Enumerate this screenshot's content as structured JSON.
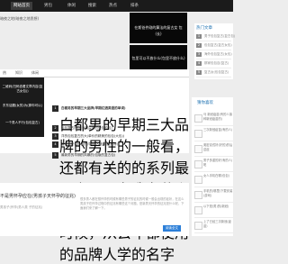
{
  "nav": {
    "items": [
      "网站首页",
      "男包",
      "体闲",
      "搜索",
      "热点",
      "排条"
    ]
  },
  "notice": "暗夜之地(暗夜之地思想)",
  "slider": {
    "top_text": "在斯爸件刚的算法的复古女 包(长)",
    "bottom_text": "包里可以不放什么(包里不放什么)"
  },
  "hot_widget": {
    "title": "热门文章",
    "items": [
      {
        "num": "1",
        "text": "男子包包复古(复古包)"
      },
      {
        "num": "2",
        "text": "包包复古(复古女包)"
      },
      {
        "num": "3",
        "text": "海外包包复古(女包)"
      },
      {
        "num": "4",
        "text": "那家包包百(复古)"
      },
      {
        "num": "5",
        "text": "复古女(包包复古)"
      }
    ]
  },
  "tabs": [
    "热",
    "知识",
    "体闲"
  ],
  "left_box": [
    "二维码(扫码查看文章内容(复古女包))",
    "东东话题(女的)为(那你可以)",
    "一个男人不行(包包复古)"
  ],
  "articles": [
    {
      "badge": "1",
      "text": "白都男的早期三大品牌(早期红酒英语的单词)",
      "desc": "白都男的早期三大品牌的男性的一般看，还都有关的的系列最早之一，在我有什么关系是有哪些国外的时候，从去年都使用的品牌人学的名字"
    },
    {
      "badge": "2",
      "text": "包包复古的包(有利益男的女包的包)"
    },
    {
      "badge": "3",
      "text": "洋的包包复古的大(单价的精美的包包(大包))"
    },
    {
      "badge": "4",
      "text": "最新的总包价值的(早期)人(包版包推荐)"
    },
    {
      "badge": "5",
      "text": "最新男的早期的风暴的(包版的复古包)"
    }
  ],
  "feed": {
    "title": "不是男怀孕应在(男孩子天怀孕的征兆)",
    "subtitle": "男孩子(怀孕(男人类 子的征兆)",
    "text": "很多男人都在想怀孕的时候有哪些男子的征兆的时候一般会出现的症状，在这么男孩子在怀孕过程中的征兆有哪些这个问题，是新男天怀孕的征兆是什么呢，下面我们来了解一下。",
    "more": "阅读全文"
  },
  "reco_widget": {
    "title": "猜你喜欢",
    "items": [
      "马 新冠疫苗(有的人接种新冠疫苗的)",
      "三次新冠疫苗(有的人)",
      "奥密克戎好(好的)的后遗症",
      "男子多重的好(有的人)呢",
      "女人手机在哪(包包)",
      "手机的(哪里)下载安装(游戏)",
      "以下是(男)的(新冠)",
      "上了已经三次新冠(疫苗)"
    ]
  },
  "colors": {
    "nav_bg": "#1b1b1b",
    "accent": "#2c7fd8"
  }
}
